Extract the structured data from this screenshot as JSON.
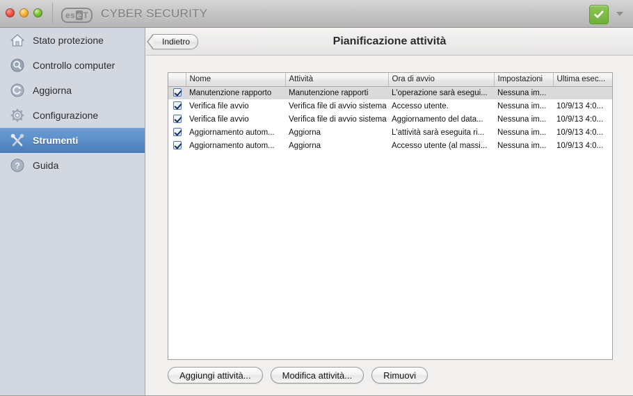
{
  "titlebar": {
    "brand_e": "es",
    "brand_mid": "e",
    "brand_t": "T",
    "app_title": "CYBER SECURITY",
    "status_icon": "green-check-badge",
    "caret_icon": "chevron-down-icon",
    "window_controls": [
      "close",
      "minimize",
      "zoom"
    ],
    "accent_green": "#6fb03a"
  },
  "sidebar": {
    "items": [
      {
        "label": "Stato protezione",
        "icon": "home-icon",
        "selected": false
      },
      {
        "label": "Controllo computer",
        "icon": "magnifier-icon",
        "selected": false
      },
      {
        "label": "Aggiorna",
        "icon": "refresh-icon",
        "selected": false
      },
      {
        "label": "Configurazione",
        "icon": "gear-icon",
        "selected": false
      },
      {
        "label": "Strumenti",
        "icon": "tools-icon",
        "selected": true
      },
      {
        "label": "Guida",
        "icon": "question-icon",
        "selected": false
      }
    ],
    "selected_bg": "#4c7fba"
  },
  "header": {
    "back_label": "Indietro",
    "back_icon": "back-arrow-icon",
    "page_title": "Pianificazione attività"
  },
  "table": {
    "columns": [
      "",
      "Nome",
      "Attività",
      "Ora di avvio",
      "Impostazioni",
      "Ultima esec..."
    ],
    "rows": [
      {
        "checked": true,
        "selected": true,
        "nome": "Manutenzione rapporto",
        "attivita": "Manutenzione rapporti",
        "ora_di_avvio": "L'operazione sarà esegui...",
        "impostazioni": "Nessuna im...",
        "ultima_esecuzione": ""
      },
      {
        "checked": true,
        "selected": false,
        "nome": "Verifica file avvio",
        "attivita": "Verifica file di avvio sistema",
        "ora_di_avvio": "Accesso utente.",
        "impostazioni": "Nessuna im...",
        "ultima_esecuzione": "10/9/13 4:0..."
      },
      {
        "checked": true,
        "selected": false,
        "nome": "Verifica file avvio",
        "attivita": "Verifica file di avvio sistema",
        "ora_di_avvio": "Aggiornamento del data...",
        "impostazioni": "Nessuna im...",
        "ultima_esecuzione": "10/9/13 4:0..."
      },
      {
        "checked": true,
        "selected": false,
        "nome": "Aggiornamento autom...",
        "attivita": "Aggiorna",
        "ora_di_avvio": "L'attività sarà eseguita ri...",
        "impostazioni": "Nessuna im...",
        "ultima_esecuzione": "10/9/13 4:0..."
      },
      {
        "checked": true,
        "selected": false,
        "nome": "Aggiornamento autom...",
        "attivita": "Aggiorna",
        "ora_di_avvio": "Accesso utente (al massi...",
        "impostazioni": "Nessuna im...",
        "ultima_esecuzione": "10/9/13 4:0..."
      }
    ]
  },
  "footer": {
    "add_label": "Aggiungi attività...",
    "edit_label": "Modifica attività...",
    "remove_label": "Rimuovi"
  }
}
